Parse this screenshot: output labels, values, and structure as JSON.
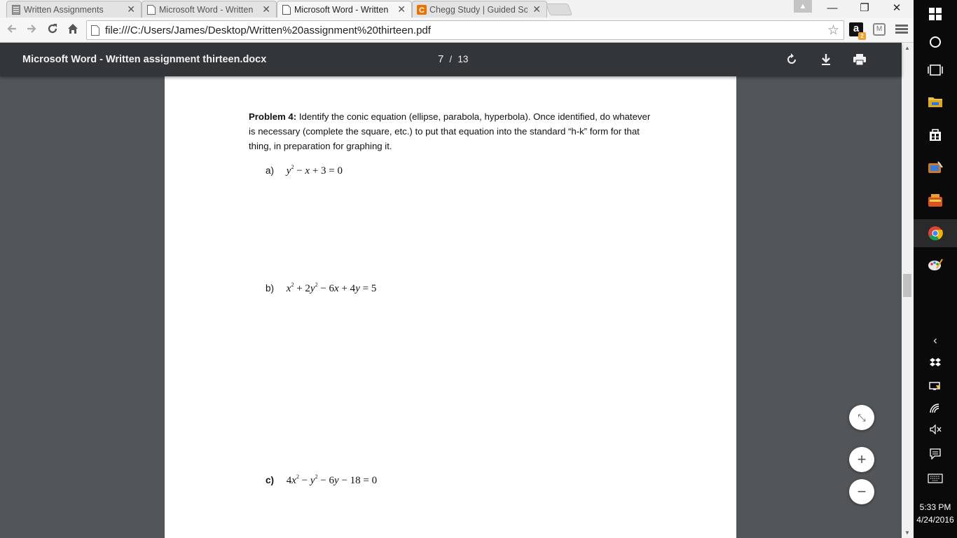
{
  "browser": {
    "tabs": [
      {
        "label": "Written Assignments",
        "icon": "document-icon",
        "active": false
      },
      {
        "label": "Microsoft Word - Written",
        "icon": "page-icon",
        "active": false
      },
      {
        "label": "Microsoft Word - Written",
        "icon": "page-icon",
        "active": true
      },
      {
        "label": "Chegg Study | Guided Sol",
        "icon": "chegg-icon",
        "active": false
      }
    ],
    "tab_close": "✕",
    "url": "file:///C:/Users/James/Desktop/Written%20assignment%20thirteen.pdf",
    "extensions": {
      "amazon": "a",
      "amazon_badge": "2",
      "shield": "M"
    }
  },
  "pdf": {
    "title": "Microsoft Word - Written assignment thirteen.docx",
    "current_page": "7",
    "separator": "/",
    "total_pages": "13"
  },
  "document": {
    "problem_label": "Problem 4:",
    "problem_text": " Identify the conic equation (ellipse, parabola, hyperbola). Once identified, do whatever is necessary (complete the square, etc.) to put that equation into the standard “h-k” form for that thing, in preparation for graphing it.",
    "parts": [
      {
        "label": "a)",
        "eq_html": "y<sup>2</sup> − x + 3 = 0"
      },
      {
        "label": "b)",
        "eq_html": "x<sup>2</sup> + 2y<sup>2</sup> − 6x + 4y = 5"
      },
      {
        "label": "c)",
        "eq_html": "4x<sup>2</sup> − y<sup>2</sup> − 6y − 18 = 0"
      }
    ]
  },
  "zoom": {
    "fit": "⤡",
    "in": "+",
    "out": "−"
  },
  "taskbar": {
    "time": "5:33 PM",
    "date": "4/24/2016"
  }
}
